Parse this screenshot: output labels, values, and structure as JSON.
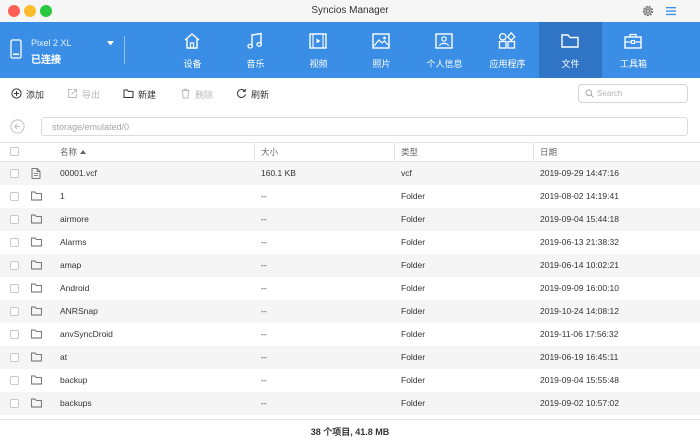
{
  "window": {
    "title": "Syncios Manager",
    "colors": {
      "nav_bg": "#3a8ee6",
      "nav_active": "#2f74c5",
      "close": "#fc5f57",
      "minimize": "#fdbc2e",
      "maximize": "#29c840"
    }
  },
  "device": {
    "name": "Pixel 2 XL",
    "status": "已连接"
  },
  "nav": {
    "tabs": [
      {
        "label": "设备",
        "icon": "home-icon"
      },
      {
        "label": "音乐",
        "icon": "music-icon"
      },
      {
        "label": "视频",
        "icon": "video-icon"
      },
      {
        "label": "照片",
        "icon": "photo-icon"
      },
      {
        "label": "个人信息",
        "icon": "contact-card-icon"
      },
      {
        "label": "应用程序",
        "icon": "apps-icon"
      },
      {
        "label": "文件",
        "icon": "folder-icon",
        "active": true
      },
      {
        "label": "工具箱",
        "icon": "toolbox-icon"
      }
    ]
  },
  "toolbar": {
    "add": "添加",
    "export": "导出",
    "new": "新建",
    "delete": "删除",
    "refresh": "刷新",
    "search_placeholder": "Search"
  },
  "path": {
    "value": "storage/emulated/0"
  },
  "table": {
    "headers": {
      "name": "名称",
      "size": "大小",
      "type": "类型",
      "date": "日期"
    },
    "rows": [
      {
        "name": "00001.vcf",
        "size": "160.1 KB",
        "type": "vcf",
        "date": "2019-09-29 14:47:16",
        "icon": "file-icon"
      },
      {
        "name": "1",
        "size": "--",
        "type": "Folder",
        "date": "2019-08-02 14:19:41",
        "icon": "folder-icon"
      },
      {
        "name": "airmore",
        "size": "--",
        "type": "Folder",
        "date": "2019-09-04 15:44:18",
        "icon": "folder-icon"
      },
      {
        "name": "Alarms",
        "size": "--",
        "type": "Folder",
        "date": "2019-06-13 21:38:32",
        "icon": "folder-icon"
      },
      {
        "name": "amap",
        "size": "--",
        "type": "Folder",
        "date": "2019-06-14 10:02:21",
        "icon": "folder-icon"
      },
      {
        "name": "Android",
        "size": "--",
        "type": "Folder",
        "date": "2019-09-09 16:00:10",
        "icon": "folder-icon"
      },
      {
        "name": "ANRSnap",
        "size": "--",
        "type": "Folder",
        "date": "2019-10-24 14:08:12",
        "icon": "folder-icon"
      },
      {
        "name": "anvSyncDroid",
        "size": "--",
        "type": "Folder",
        "date": "2019-11-06 17:56:32",
        "icon": "folder-icon"
      },
      {
        "name": "at",
        "size": "--",
        "type": "Folder",
        "date": "2019-06-19 16:45:11",
        "icon": "folder-icon"
      },
      {
        "name": "backup",
        "size": "--",
        "type": "Folder",
        "date": "2019-09-04 15:55:48",
        "icon": "folder-icon"
      },
      {
        "name": "backups",
        "size": "--",
        "type": "Folder",
        "date": "2019-09-02 10:57:02",
        "icon": "folder-icon"
      }
    ]
  },
  "footer": {
    "summary": "38 个项目, 41.8 MB"
  }
}
